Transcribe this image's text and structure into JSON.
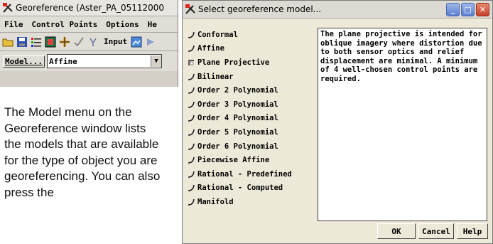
{
  "geo_window": {
    "title": "Georeference (Aster_PA_05112000",
    "menus": [
      "File",
      "Control Points",
      "Options",
      "He"
    ],
    "toolbar_input_label": "Input",
    "model_button_label": "Model...",
    "model_value": "Affine"
  },
  "caption": "The Model menu on the Georeference window lists the models that are available for the type of object you are georeferencing.  You can also press the",
  "select_dialog": {
    "title": "Select georeference model...",
    "models": [
      {
        "label": "Conformal",
        "selected": false
      },
      {
        "label": "Affine",
        "selected": false
      },
      {
        "label": "Plane Projective",
        "selected": true
      },
      {
        "label": "Bilinear",
        "selected": false
      },
      {
        "label": "Order 2 Polynomial",
        "selected": false
      },
      {
        "label": "Order 3 Polynomial",
        "selected": false
      },
      {
        "label": "Order 4 Polynomial",
        "selected": false
      },
      {
        "label": "Order 5 Polynomial",
        "selected": false
      },
      {
        "label": "Order 6 Polynomial",
        "selected": false
      },
      {
        "label": "Piecewise Affine",
        "selected": false
      },
      {
        "label": "Rational - Predefined",
        "selected": false
      },
      {
        "label": "Rational - Computed",
        "selected": false
      },
      {
        "label": "Manifold",
        "selected": false
      }
    ],
    "description": "The plane projective is intended for oblique imagery where distortion due to both sensor optics and relief displacement are minimal. A minimum of 4 well-chosen control points are required.",
    "buttons": {
      "ok": "OK",
      "cancel": "Cancel",
      "help": "Help"
    }
  }
}
